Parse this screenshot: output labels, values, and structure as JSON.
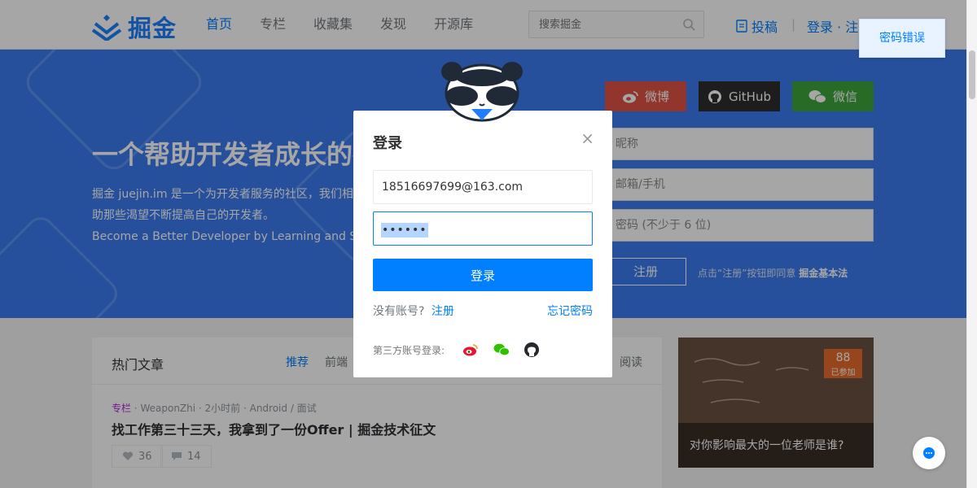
{
  "header": {
    "logo_text": "掘金",
    "nav": [
      "首页",
      "专栏",
      "收藏集",
      "发现",
      "开源库"
    ],
    "search_placeholder": "搜索掘金",
    "write_label": "投稿",
    "separator": "|",
    "login_register": "登录 · 注册"
  },
  "toast": {
    "message": "密码错误"
  },
  "banner": {
    "slogan": "一个帮助开发者成长的社区",
    "desc_line1": "掘金 juejin.im 是一个为开发者服务的社区，我们相信",
    "desc_line2": "助那些渴望不断提高自己的开发者。",
    "desc_line3": "Become a Better Developer by Learning and Sharing",
    "social": {
      "weibo": "微博",
      "github": "GitHub",
      "wechat": "微信"
    },
    "register_form": {
      "nickname_placeholder": "昵称",
      "account_placeholder": "邮箱/手机",
      "password_placeholder": "密码 (不少于 6 位)",
      "register_button": "注册",
      "agree_text": "点击“注册”按钮即同意",
      "agree_link": "掘金基本法"
    }
  },
  "articles": {
    "title": "热门文章",
    "tabs": [
      "推荐",
      "前端",
      "阅读"
    ],
    "item": {
      "column": "专栏",
      "meta": " · WeaponZhi · 2小时前 · Android / 面试",
      "title": "找工作第三十三天，我拿到了一份Offer | 掘金技术征文",
      "likes": "36",
      "comments": "14"
    }
  },
  "sidecard": {
    "count": "88",
    "count_label": "已参加",
    "caption": "对你影响最大的一位老师是谁?"
  },
  "modal": {
    "title": "登录",
    "close": "×",
    "email_value": "18516697699@163.com",
    "password_masked": "••••••",
    "login_button": "登录",
    "no_account": "没有账号?",
    "register_link": "注册",
    "forgot_link": "忘记密码",
    "third_party_label": "第三方账号登录:"
  },
  "colors": {
    "accent": "#007fff",
    "banner": "#3c7cf0",
    "weibo": "#e05244",
    "github": "#2d2d2d",
    "wechat": "#3ea53c"
  }
}
